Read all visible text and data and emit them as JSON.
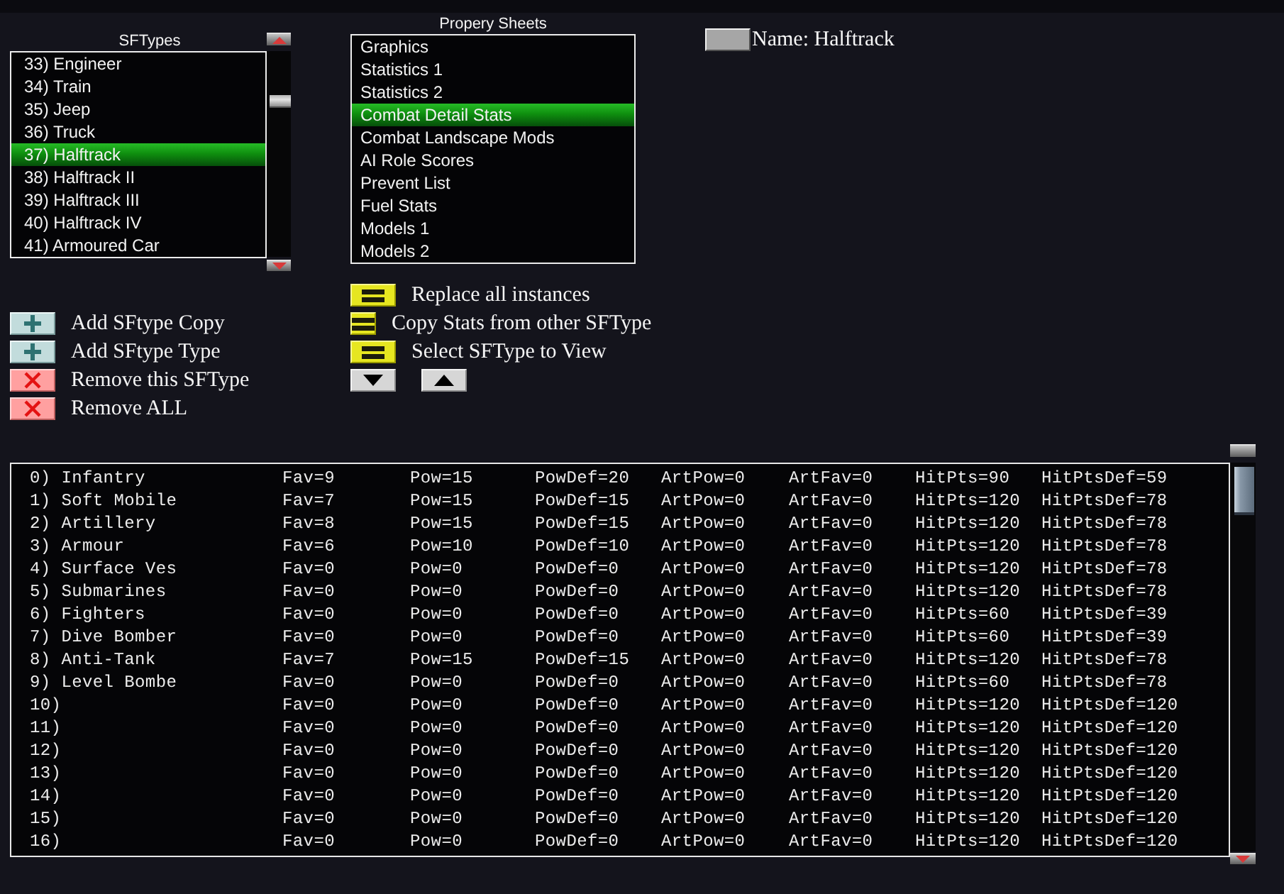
{
  "sftypes": {
    "title": "SFTypes",
    "items": [
      {
        "label": "33) Engineer",
        "selected": false
      },
      {
        "label": "34) Train",
        "selected": false
      },
      {
        "label": "35) Jeep",
        "selected": false
      },
      {
        "label": "36) Truck",
        "selected": false
      },
      {
        "label": "37) Halftrack",
        "selected": true
      },
      {
        "label": "38) Halftrack II",
        "selected": false
      },
      {
        "label": "39) Halftrack III",
        "selected": false
      },
      {
        "label": "40) Halftrack IV",
        "selected": false
      },
      {
        "label": "41) Armoured Car",
        "selected": false
      }
    ]
  },
  "property_sheets": {
    "title": "Propery Sheets",
    "items": [
      {
        "label": "Graphics",
        "selected": false
      },
      {
        "label": "Statistics 1",
        "selected": false
      },
      {
        "label": "Statistics 2",
        "selected": false
      },
      {
        "label": "Combat Detail Stats",
        "selected": true
      },
      {
        "label": "Combat Landscape Mods",
        "selected": false
      },
      {
        "label": "AI Role Scores",
        "selected": false
      },
      {
        "label": "Prevent List",
        "selected": false
      },
      {
        "label": "Fuel Stats",
        "selected": false
      },
      {
        "label": "Models 1",
        "selected": false
      },
      {
        "label": "Models 2",
        "selected": false
      }
    ]
  },
  "name_field": {
    "label": "Name: Halftrack"
  },
  "sftype_actions": [
    {
      "kind": "add",
      "label": "Add SFtype Copy"
    },
    {
      "kind": "add",
      "label": "Add SFtype Type"
    },
    {
      "kind": "remove",
      "label": "Remove this SFType"
    },
    {
      "kind": "remove",
      "label": "Remove ALL"
    }
  ],
  "sheet_actions": [
    {
      "kind": "apply",
      "label": "Replace all instances"
    },
    {
      "kind": "apply",
      "label": "Copy Stats from other SFType"
    },
    {
      "kind": "apply",
      "label": "Select SFType to View"
    }
  ],
  "arrow_buttons": [
    {
      "kind": "down"
    },
    {
      "kind": "up"
    }
  ],
  "table": {
    "rows": [
      {
        "label": "0) Infantry",
        "fav": "Fav=9",
        "pow": "Pow=15",
        "pow_def": "PowDef=20",
        "art_pow": "ArtPow=0",
        "art_fav": "ArtFav=0",
        "hit_pts": "HitPts=90",
        "hit_pts_def": "HitPtsDef=59"
      },
      {
        "label": "1) Soft Mobile",
        "fav": "Fav=7",
        "pow": "Pow=15",
        "pow_def": "PowDef=15",
        "art_pow": "ArtPow=0",
        "art_fav": "ArtFav=0",
        "hit_pts": "HitPts=120",
        "hit_pts_def": "HitPtsDef=78"
      },
      {
        "label": "2) Artillery",
        "fav": "Fav=8",
        "pow": "Pow=15",
        "pow_def": "PowDef=15",
        "art_pow": "ArtPow=0",
        "art_fav": "ArtFav=0",
        "hit_pts": "HitPts=120",
        "hit_pts_def": "HitPtsDef=78"
      },
      {
        "label": "3) Armour",
        "fav": "Fav=6",
        "pow": "Pow=10",
        "pow_def": "PowDef=10",
        "art_pow": "ArtPow=0",
        "art_fav": "ArtFav=0",
        "hit_pts": "HitPts=120",
        "hit_pts_def": "HitPtsDef=78"
      },
      {
        "label": "4) Surface Ves",
        "fav": "Fav=0",
        "pow": "Pow=0",
        "pow_def": "PowDef=0",
        "art_pow": "ArtPow=0",
        "art_fav": "ArtFav=0",
        "hit_pts": "HitPts=120",
        "hit_pts_def": "HitPtsDef=78"
      },
      {
        "label": "5) Submarines",
        "fav": "Fav=0",
        "pow": "Pow=0",
        "pow_def": "PowDef=0",
        "art_pow": "ArtPow=0",
        "art_fav": "ArtFav=0",
        "hit_pts": "HitPts=120",
        "hit_pts_def": "HitPtsDef=78"
      },
      {
        "label": "6) Fighters",
        "fav": "Fav=0",
        "pow": "Pow=0",
        "pow_def": "PowDef=0",
        "art_pow": "ArtPow=0",
        "art_fav": "ArtFav=0",
        "hit_pts": "HitPts=60",
        "hit_pts_def": "HitPtsDef=39"
      },
      {
        "label": "7) Dive Bomber",
        "fav": "Fav=0",
        "pow": "Pow=0",
        "pow_def": "PowDef=0",
        "art_pow": "ArtPow=0",
        "art_fav": "ArtFav=0",
        "hit_pts": "HitPts=60",
        "hit_pts_def": "HitPtsDef=39"
      },
      {
        "label": "8) Anti-Tank",
        "fav": "Fav=7",
        "pow": "Pow=15",
        "pow_def": "PowDef=15",
        "art_pow": "ArtPow=0",
        "art_fav": "ArtFav=0",
        "hit_pts": "HitPts=120",
        "hit_pts_def": "HitPtsDef=78"
      },
      {
        "label": "9) Level Bombe",
        "fav": "Fav=0",
        "pow": "Pow=0",
        "pow_def": "PowDef=0",
        "art_pow": "ArtPow=0",
        "art_fav": "ArtFav=0",
        "hit_pts": "HitPts=60",
        "hit_pts_def": "HitPtsDef=78"
      },
      {
        "label": "10)",
        "fav": "Fav=0",
        "pow": "Pow=0",
        "pow_def": "PowDef=0",
        "art_pow": "ArtPow=0",
        "art_fav": "ArtFav=0",
        "hit_pts": "HitPts=120",
        "hit_pts_def": "HitPtsDef=120"
      },
      {
        "label": "11)",
        "fav": "Fav=0",
        "pow": "Pow=0",
        "pow_def": "PowDef=0",
        "art_pow": "ArtPow=0",
        "art_fav": "ArtFav=0",
        "hit_pts": "HitPts=120",
        "hit_pts_def": "HitPtsDef=120"
      },
      {
        "label": "12)",
        "fav": "Fav=0",
        "pow": "Pow=0",
        "pow_def": "PowDef=0",
        "art_pow": "ArtPow=0",
        "art_fav": "ArtFav=0",
        "hit_pts": "HitPts=120",
        "hit_pts_def": "HitPtsDef=120"
      },
      {
        "label": "13)",
        "fav": "Fav=0",
        "pow": "Pow=0",
        "pow_def": "PowDef=0",
        "art_pow": "ArtPow=0",
        "art_fav": "ArtFav=0",
        "hit_pts": "HitPts=120",
        "hit_pts_def": "HitPtsDef=120"
      },
      {
        "label": "14)",
        "fav": "Fav=0",
        "pow": "Pow=0",
        "pow_def": "PowDef=0",
        "art_pow": "ArtPow=0",
        "art_fav": "ArtFav=0",
        "hit_pts": "HitPts=120",
        "hit_pts_def": "HitPtsDef=120"
      },
      {
        "label": "15)",
        "fav": "Fav=0",
        "pow": "Pow=0",
        "pow_def": "PowDef=0",
        "art_pow": "ArtPow=0",
        "art_fav": "ArtFav=0",
        "hit_pts": "HitPts=120",
        "hit_pts_def": "HitPtsDef=120"
      },
      {
        "label": "16)",
        "fav": "Fav=0",
        "pow": "Pow=0",
        "pow_def": "PowDef=0",
        "art_pow": "ArtPow=0",
        "art_fav": "ArtFav=0",
        "hit_pts": "HitPts=120",
        "hit_pts_def": "HitPtsDef=120"
      }
    ]
  }
}
